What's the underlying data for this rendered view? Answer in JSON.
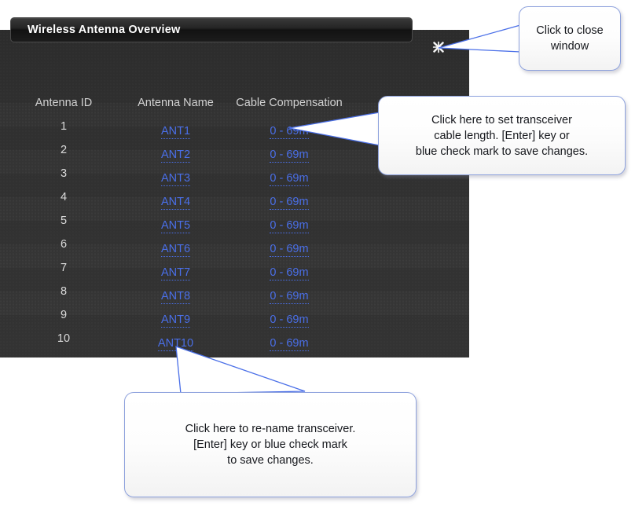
{
  "window": {
    "title": "Wireless Antenna Overview",
    "close_icon": "close-x-icon"
  },
  "table": {
    "headers": {
      "id": "Antenna ID",
      "name": "Antenna Name",
      "cable": "Cable Compensation"
    },
    "rows": [
      {
        "id": "1",
        "name": "ANT1",
        "cable": "0 - 69m"
      },
      {
        "id": "2",
        "name": "ANT2",
        "cable": "0 - 69m"
      },
      {
        "id": "3",
        "name": "ANT3",
        "cable": "0 - 69m"
      },
      {
        "id": "4",
        "name": "ANT4",
        "cable": "0 - 69m"
      },
      {
        "id": "5",
        "name": "ANT5",
        "cable": "0 - 69m"
      },
      {
        "id": "6",
        "name": "ANT6",
        "cable": "0 - 69m"
      },
      {
        "id": "7",
        "name": "ANT7",
        "cable": "0 - 69m"
      },
      {
        "id": "8",
        "name": "ANT8",
        "cable": "0 - 69m"
      },
      {
        "id": "9",
        "name": "ANT9",
        "cable": "0 - 69m"
      },
      {
        "id": "10",
        "name": "ANT10",
        "cable": "0 - 69m"
      }
    ]
  },
  "callouts": {
    "close": "Click to close\nwindow",
    "cable": "Click here to set transceiver\ncable length. [Enter] key or\nblue check mark to save changes.",
    "rename": "Click here to re-name transceiver.\n[Enter] key or blue check mark\nto save changes."
  },
  "colors": {
    "link": "#4a6fe8",
    "callout_border": "#8ea2dd",
    "panel_bg": "#2f2f2f"
  }
}
